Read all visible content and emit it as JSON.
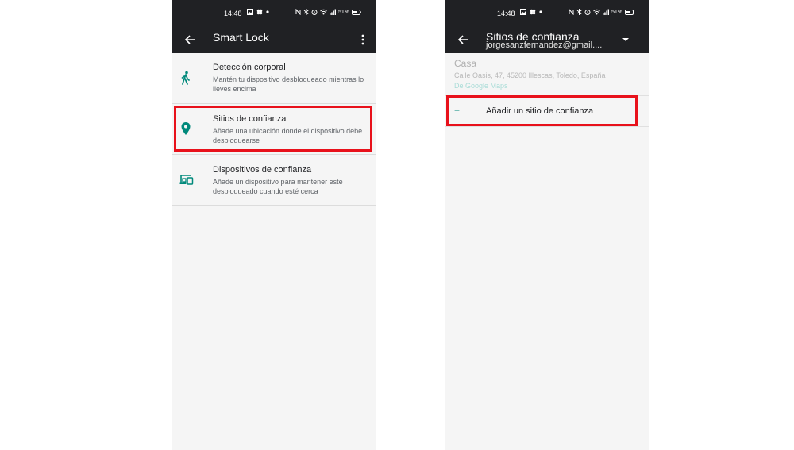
{
  "left_screen": {
    "status_bar": {
      "time": "14:48",
      "battery": "51%"
    },
    "app_bar": {
      "title": "Smart Lock",
      "back_icon": "arrow-back-icon",
      "menu_icon": "more-vert-icon"
    },
    "items": [
      {
        "icon": "walk-icon",
        "title": "Detección corporal",
        "summary": "Mantén tu dispositivo desbloqueado mientras lo lleves encima"
      },
      {
        "icon": "location-pin-icon",
        "title": "Sitios de confianza",
        "summary": "Añade una ubicación donde el dispositivo debe desbloquearse"
      },
      {
        "icon": "devices-icon",
        "title": "Dispositivos de confianza",
        "summary": "Añade un dispositivo para mantener este desbloqueado cuando esté cerca"
      }
    ]
  },
  "right_screen": {
    "status_bar": {
      "time": "14:48",
      "battery": "51%"
    },
    "app_bar": {
      "title": "Sitios de confianza",
      "subtitle": "jorgesanzfernandez@gmail....",
      "back_icon": "arrow-back-icon",
      "dropdown_icon": "dropdown-arrow-icon"
    },
    "place": {
      "name": "Casa",
      "address": "Calle Oasis, 47, 45200 Illescas, Toledo, España",
      "source": "De Google Maps"
    },
    "add_site": {
      "plus": "+",
      "label": "Añadir un sitio de confianza"
    }
  },
  "colors": {
    "app_bar": "#202124",
    "accent": "#00897b",
    "highlight": "#e8111b",
    "background": "#f5f5f5"
  }
}
